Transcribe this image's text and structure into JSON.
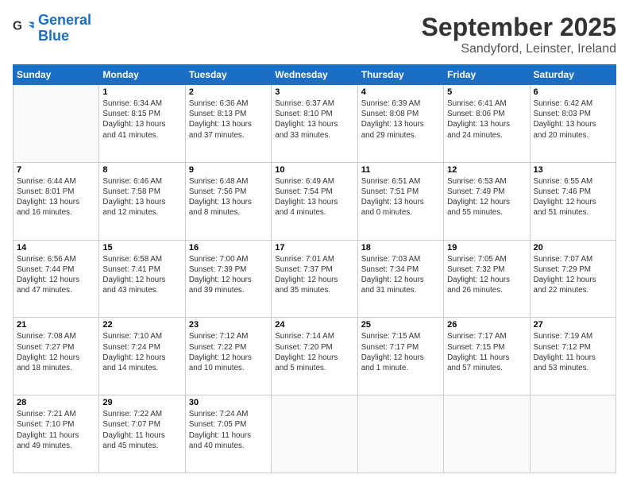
{
  "logo": {
    "line1": "General",
    "line2": "Blue"
  },
  "header": {
    "month": "September 2025",
    "location": "Sandyford, Leinster, Ireland"
  },
  "days_of_week": [
    "Sunday",
    "Monday",
    "Tuesday",
    "Wednesday",
    "Thursday",
    "Friday",
    "Saturday"
  ],
  "weeks": [
    [
      {
        "day": "",
        "info": ""
      },
      {
        "day": "1",
        "info": "Sunrise: 6:34 AM\nSunset: 8:15 PM\nDaylight: 13 hours\nand 41 minutes."
      },
      {
        "day": "2",
        "info": "Sunrise: 6:36 AM\nSunset: 8:13 PM\nDaylight: 13 hours\nand 37 minutes."
      },
      {
        "day": "3",
        "info": "Sunrise: 6:37 AM\nSunset: 8:10 PM\nDaylight: 13 hours\nand 33 minutes."
      },
      {
        "day": "4",
        "info": "Sunrise: 6:39 AM\nSunset: 8:08 PM\nDaylight: 13 hours\nand 29 minutes."
      },
      {
        "day": "5",
        "info": "Sunrise: 6:41 AM\nSunset: 8:06 PM\nDaylight: 13 hours\nand 24 minutes."
      },
      {
        "day": "6",
        "info": "Sunrise: 6:42 AM\nSunset: 8:03 PM\nDaylight: 13 hours\nand 20 minutes."
      }
    ],
    [
      {
        "day": "7",
        "info": "Sunrise: 6:44 AM\nSunset: 8:01 PM\nDaylight: 13 hours\nand 16 minutes."
      },
      {
        "day": "8",
        "info": "Sunrise: 6:46 AM\nSunset: 7:58 PM\nDaylight: 13 hours\nand 12 minutes."
      },
      {
        "day": "9",
        "info": "Sunrise: 6:48 AM\nSunset: 7:56 PM\nDaylight: 13 hours\nand 8 minutes."
      },
      {
        "day": "10",
        "info": "Sunrise: 6:49 AM\nSunset: 7:54 PM\nDaylight: 13 hours\nand 4 minutes."
      },
      {
        "day": "11",
        "info": "Sunrise: 6:51 AM\nSunset: 7:51 PM\nDaylight: 13 hours\nand 0 minutes."
      },
      {
        "day": "12",
        "info": "Sunrise: 6:53 AM\nSunset: 7:49 PM\nDaylight: 12 hours\nand 55 minutes."
      },
      {
        "day": "13",
        "info": "Sunrise: 6:55 AM\nSunset: 7:46 PM\nDaylight: 12 hours\nand 51 minutes."
      }
    ],
    [
      {
        "day": "14",
        "info": "Sunrise: 6:56 AM\nSunset: 7:44 PM\nDaylight: 12 hours\nand 47 minutes."
      },
      {
        "day": "15",
        "info": "Sunrise: 6:58 AM\nSunset: 7:41 PM\nDaylight: 12 hours\nand 43 minutes."
      },
      {
        "day": "16",
        "info": "Sunrise: 7:00 AM\nSunset: 7:39 PM\nDaylight: 12 hours\nand 39 minutes."
      },
      {
        "day": "17",
        "info": "Sunrise: 7:01 AM\nSunset: 7:37 PM\nDaylight: 12 hours\nand 35 minutes."
      },
      {
        "day": "18",
        "info": "Sunrise: 7:03 AM\nSunset: 7:34 PM\nDaylight: 12 hours\nand 31 minutes."
      },
      {
        "day": "19",
        "info": "Sunrise: 7:05 AM\nSunset: 7:32 PM\nDaylight: 12 hours\nand 26 minutes."
      },
      {
        "day": "20",
        "info": "Sunrise: 7:07 AM\nSunset: 7:29 PM\nDaylight: 12 hours\nand 22 minutes."
      }
    ],
    [
      {
        "day": "21",
        "info": "Sunrise: 7:08 AM\nSunset: 7:27 PM\nDaylight: 12 hours\nand 18 minutes."
      },
      {
        "day": "22",
        "info": "Sunrise: 7:10 AM\nSunset: 7:24 PM\nDaylight: 12 hours\nand 14 minutes."
      },
      {
        "day": "23",
        "info": "Sunrise: 7:12 AM\nSunset: 7:22 PM\nDaylight: 12 hours\nand 10 minutes."
      },
      {
        "day": "24",
        "info": "Sunrise: 7:14 AM\nSunset: 7:20 PM\nDaylight: 12 hours\nand 5 minutes."
      },
      {
        "day": "25",
        "info": "Sunrise: 7:15 AM\nSunset: 7:17 PM\nDaylight: 12 hours\nand 1 minute."
      },
      {
        "day": "26",
        "info": "Sunrise: 7:17 AM\nSunset: 7:15 PM\nDaylight: 11 hours\nand 57 minutes."
      },
      {
        "day": "27",
        "info": "Sunrise: 7:19 AM\nSunset: 7:12 PM\nDaylight: 11 hours\nand 53 minutes."
      }
    ],
    [
      {
        "day": "28",
        "info": "Sunrise: 7:21 AM\nSunset: 7:10 PM\nDaylight: 11 hours\nand 49 minutes."
      },
      {
        "day": "29",
        "info": "Sunrise: 7:22 AM\nSunset: 7:07 PM\nDaylight: 11 hours\nand 45 minutes."
      },
      {
        "day": "30",
        "info": "Sunrise: 7:24 AM\nSunset: 7:05 PM\nDaylight: 11 hours\nand 40 minutes."
      },
      {
        "day": "",
        "info": ""
      },
      {
        "day": "",
        "info": ""
      },
      {
        "day": "",
        "info": ""
      },
      {
        "day": "",
        "info": ""
      }
    ]
  ]
}
